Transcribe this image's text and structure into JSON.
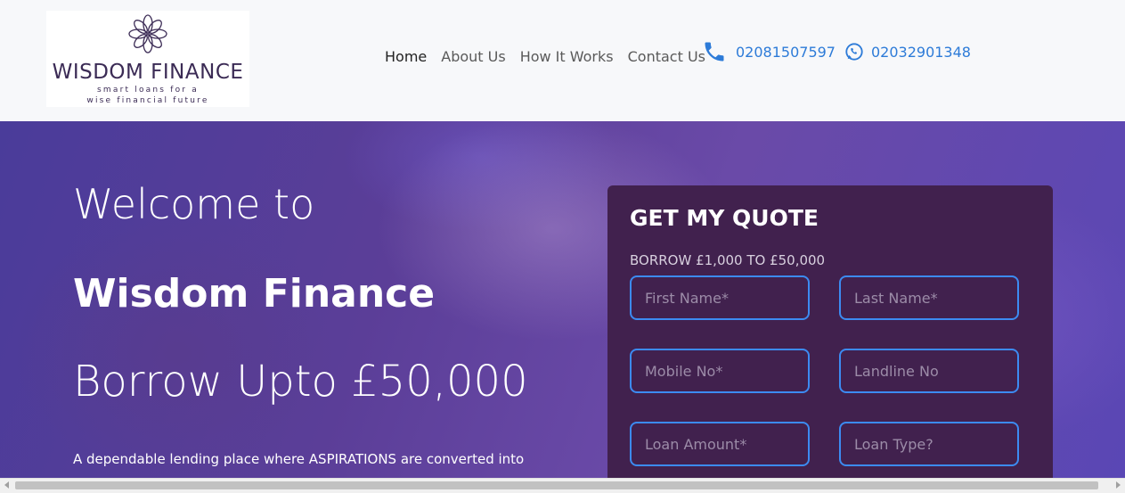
{
  "brand": {
    "name": "WISDOM FINANCE",
    "tagline_line1": "smart loans for a",
    "tagline_line2": "wise financial future"
  },
  "nav": {
    "items": [
      {
        "label": "Home",
        "active": true
      },
      {
        "label": "About Us",
        "active": false
      },
      {
        "label": "How It Works",
        "active": false
      },
      {
        "label": "Contact Us",
        "active": false
      }
    ]
  },
  "contact": {
    "phone": "02081507597",
    "whatsapp": "02032901348",
    "phone_icon": "phone-icon",
    "whatsapp_icon": "whatsapp-icon",
    "link_color": "#2d7bd8"
  },
  "hero": {
    "line1": "Welcome to",
    "line2": "Wisdom Finance",
    "line3": "Borrow Upto £50,000",
    "description": "A dependable lending place where ASPIRATIONS are converted into"
  },
  "quote_form": {
    "title": "GET MY QUOTE",
    "subtitle": "BORROW £1,000 TO £50,000",
    "fields": {
      "first_name": {
        "placeholder": "First Name*",
        "value": ""
      },
      "last_name": {
        "placeholder": "Last Name*",
        "value": ""
      },
      "mobile": {
        "placeholder": "Mobile No*",
        "value": ""
      },
      "landline": {
        "placeholder": "Landline No",
        "value": ""
      },
      "loan_amount": {
        "placeholder": "Loan Amount*",
        "value": ""
      },
      "loan_type": {
        "placeholder": "Loan Type?",
        "value": ""
      }
    },
    "panel_color": "#41214e",
    "field_border_color": "#3c8bf2"
  }
}
